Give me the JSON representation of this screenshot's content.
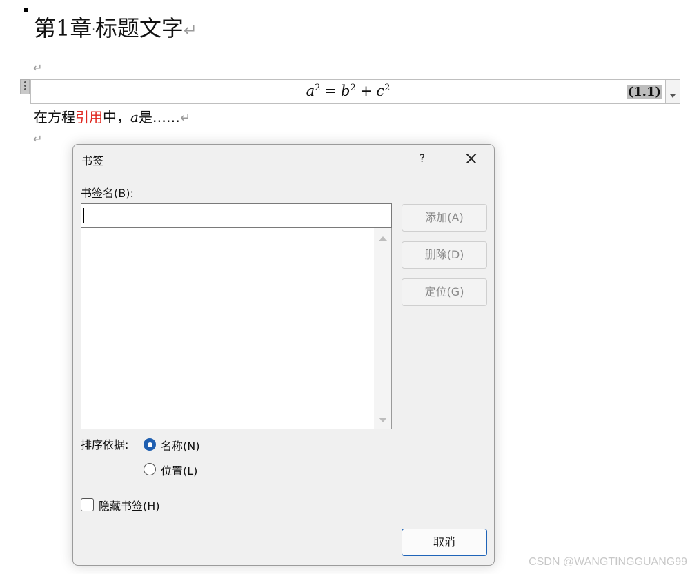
{
  "document": {
    "heading_prefix": "第",
    "heading_number": "1",
    "heading_suffix": "章",
    "heading_dot": "·",
    "heading_text": "标题文字",
    "paragraph_mark": "↵",
    "equation": {
      "a": "a",
      "b": "b",
      "c": "c",
      "exp": "2",
      "equals": "=",
      "plus": "+",
      "number": "(1.1)"
    },
    "body": {
      "before": "在方程",
      "ref": "引用",
      "after": "中，",
      "var": "a",
      "tail": "是……"
    }
  },
  "dialog": {
    "title": "书签",
    "help_label": "?",
    "name_label": "书签名(B):",
    "name_value": "",
    "buttons": {
      "add": "添加(A)",
      "delete": "删除(D)",
      "goto": "定位(G)",
      "cancel": "取消"
    },
    "sort_label": "排序依据:",
    "sort_options": [
      {
        "label": "名称(N)",
        "checked": true
      },
      {
        "label": "位置(L)",
        "checked": false
      }
    ],
    "hidden_label": "隐藏书签(H)",
    "hidden_checked": false
  },
  "watermark": "CSDN @WANGTINGGUANG99",
  "colors": {
    "accent": "#1f5fb0",
    "reference_red": "#e0271f"
  }
}
